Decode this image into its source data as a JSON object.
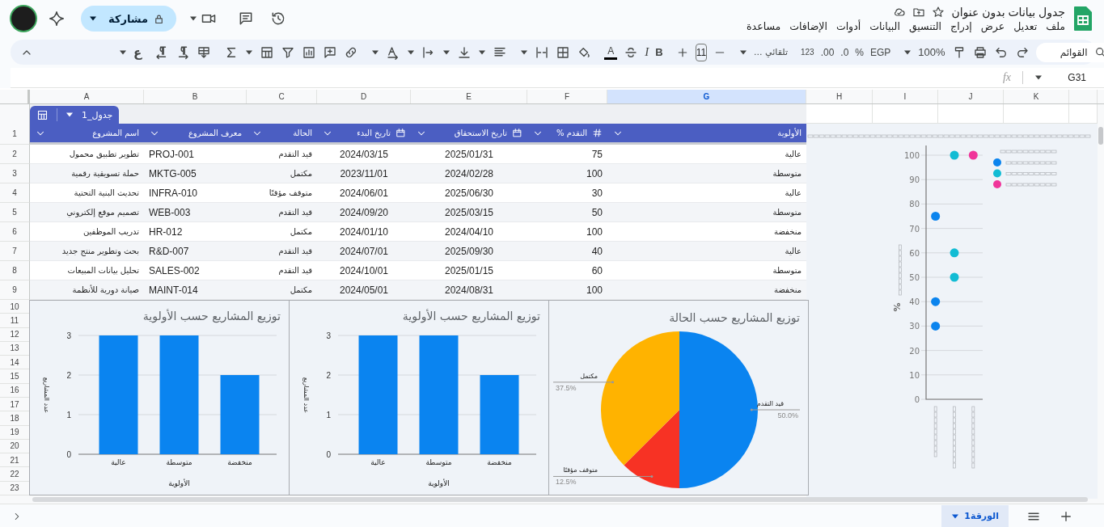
{
  "topbar": {
    "title": "جدول بيانات بدون عنوان",
    "menu": [
      "ملف",
      "تعديل",
      "عرض",
      "إدراج",
      "التنسيق",
      "البيانات",
      "أدوات",
      "الإضافات",
      "مساعدة"
    ],
    "share_label": "مشاركة"
  },
  "toolbar": {
    "input_tools": "ع",
    "text_color": "A",
    "italic": "I",
    "bold": "B",
    "font_size": "11",
    "font": "تلقائي ...",
    "number_format": "123",
    "decimal_increase": ".00",
    "decimal_decrease": ".0",
    "percent": "%",
    "currency": "EGP",
    "zoom": "100%",
    "search_placeholder": "القوائم"
  },
  "formula_bar": {
    "function_label": "fx",
    "cell_ref": "G31"
  },
  "column_headers": [
    {
      "label": "K",
      "selected": false
    },
    {
      "label": "J",
      "selected": false
    },
    {
      "label": "I",
      "selected": false
    },
    {
      "label": "H",
      "selected": false
    },
    {
      "label": "G",
      "selected": true
    },
    {
      "label": "F",
      "selected": false
    },
    {
      "label": "E",
      "selected": false
    },
    {
      "label": "D",
      "selected": false
    },
    {
      "label": "C",
      "selected": false
    },
    {
      "label": "B",
      "selected": false
    },
    {
      "label": "A",
      "selected": false
    }
  ],
  "row_numbers": [
    "1",
    "2",
    "3",
    "4",
    "5",
    "6",
    "7",
    "8",
    "9",
    "10",
    "11",
    "12",
    "13",
    "14",
    "15",
    "16",
    "17",
    "18",
    "19",
    "20",
    "21",
    "22",
    "23"
  ],
  "table": {
    "name": "جدول_1",
    "columns": [
      {
        "label": "الأولوية",
        "kind": "text"
      },
      {
        "label": "التقدم %",
        "kind": "number"
      },
      {
        "label": "تاريخ الاستحقاق",
        "kind": "date"
      },
      {
        "label": "تاريخ البدء",
        "kind": "date"
      },
      {
        "label": "الحالة",
        "kind": "text"
      },
      {
        "label": "معرف المشروع",
        "kind": "text"
      },
      {
        "label": "اسم المشروع",
        "kind": "text"
      }
    ],
    "rows": [
      [
        "عالية",
        "75",
        "2025/01/31",
        "2024/03/15",
        "قيد التقدم",
        "PROJ-001",
        "تطوير تطبيق محمول"
      ],
      [
        "متوسطة",
        "100",
        "2024/02/28",
        "2023/11/01",
        "مكتمل",
        "MKTG-005",
        "حملة تسويقية رقمية"
      ],
      [
        "عالية",
        "30",
        "2025/06/30",
        "2024/06/01",
        "متوقف مؤقتًا",
        "INFRA-010",
        "تحديث البنية التحتية"
      ],
      [
        "متوسطة",
        "50",
        "2025/03/15",
        "2024/09/20",
        "قيد التقدم",
        "WEB-003",
        "تصميم موقع إلكتروني"
      ],
      [
        "منخفضة",
        "100",
        "2024/04/10",
        "2024/01/10",
        "مكتمل",
        "HR-012",
        "تدريب الموظفين"
      ],
      [
        "عالية",
        "40",
        "2025/09/30",
        "2024/07/01",
        "قيد التقدم",
        "R&D-007",
        "بحث وتطوير منتج جديد"
      ],
      [
        "متوسطة",
        "60",
        "2025/01/15",
        "2024/10/01",
        "قيد التقدم",
        "SALES-002",
        "تحليل بيانات المبيعات"
      ],
      [
        "منخفضة",
        "100",
        "2024/08/31",
        "2024/05/01",
        "مكتمل",
        "MAINT-014",
        "صيانة دورية للأنظمة"
      ]
    ]
  },
  "charts": [
    {
      "chart_data": {
        "type": "bar",
        "title": "توزيع المشاريع حسب الأولوية",
        "xlabel": "الأولوية",
        "ylabel": "عدد المشاريع",
        "categories": [
          "عالية",
          "متوسطة",
          "منخفضة"
        ],
        "series": [
          {
            "color": "#0a84f0",
            "values": [
              3,
              3,
              2
            ]
          }
        ],
        "ylim": [
          0,
          3
        ],
        "yticks": [
          0,
          1,
          2,
          3
        ],
        "grid": true
      }
    },
    {
      "chart_data": {
        "type": "bar",
        "title": "توزيع المشاريع حسب الأولوية",
        "xlabel": "الأولوية",
        "ylabel": "عدد المشاريع",
        "categories": [
          "عالية",
          "متوسطة",
          "منخفضة"
        ],
        "series": [
          {
            "color": "#0a84f0",
            "values": [
              3,
              3,
              2
            ]
          }
        ],
        "ylim": [
          0,
          3
        ],
        "yticks": [
          0,
          1,
          2,
          3
        ],
        "grid": true
      }
    },
    {
      "chart_data": {
        "type": "pie",
        "title": "توزيع المشاريع حسب الحالة",
        "categories": [
          "قيد التقدم",
          "متوقف مؤقتًا",
          "مكتمل"
        ],
        "values": [
          50,
          12.5,
          37.5
        ],
        "colors": [
          "#0a84f0",
          "#f73224",
          "#ffb300"
        ],
        "value_labels": [
          "50.0%",
          "12.5%",
          "37.5%"
        ]
      }
    },
    {
      "chart_data": {
        "type": "scatter",
        "ylabel": "%",
        "ylim": [
          0,
          100
        ],
        "yticks": [
          0,
          10,
          20,
          30,
          40,
          50,
          60,
          70,
          80,
          90,
          100
        ],
        "grid": true,
        "series": [
          {
            "color": "#0b84ee",
            "values": [
              75,
              null,
              null
            ]
          },
          {
            "color": "#0b84ee",
            "values": [
              40,
              null,
              null
            ]
          },
          {
            "color": "#0b84ee",
            "values": [
              30,
              null,
              null
            ]
          },
          {
            "color": "#12bcd4",
            "values": [
              null,
              100,
              null
            ]
          },
          {
            "color": "#12bcd4",
            "values": [
              null,
              60,
              null
            ]
          },
          {
            "color": "#12bcd4",
            "values": [
              null,
              50,
              null
            ]
          },
          {
            "color": "#f0359a",
            "values": [
              null,
              null,
              100
            ]
          }
        ]
      }
    }
  ],
  "sheet_tabs": [
    {
      "label": "الورقة1",
      "selected": true
    }
  ]
}
